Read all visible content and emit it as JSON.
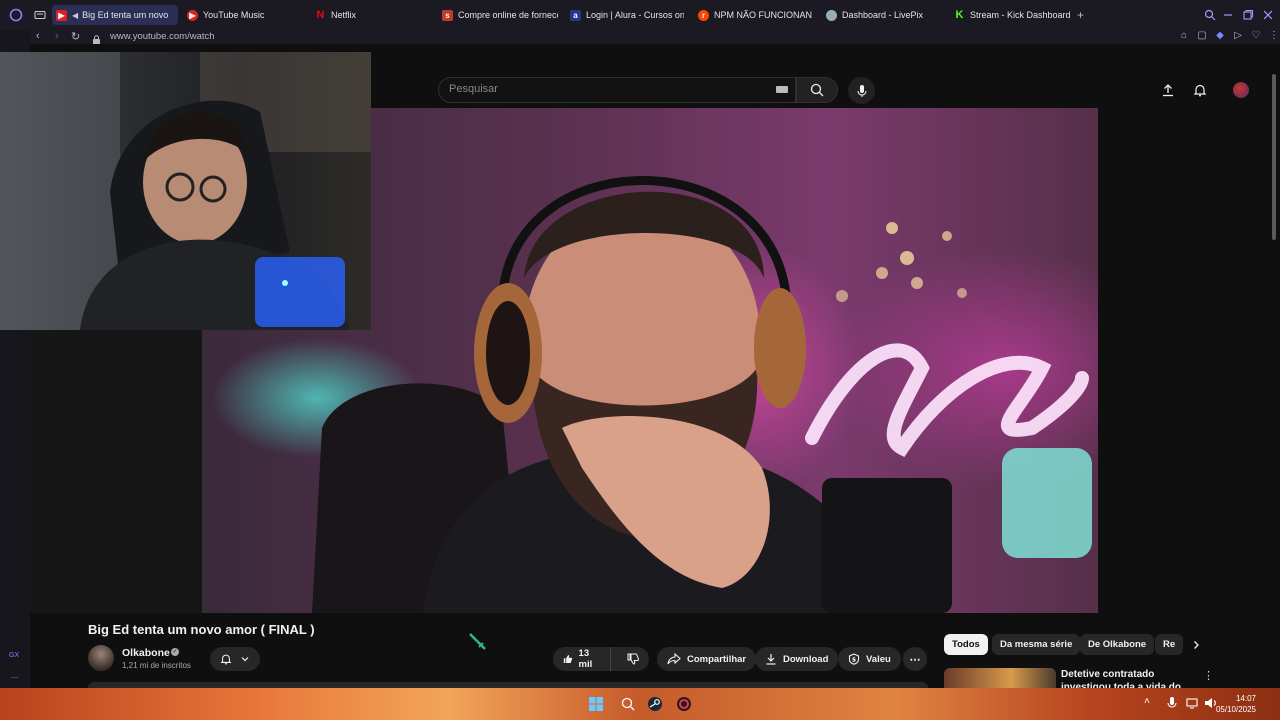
{
  "browser": {
    "tabs": [
      {
        "label": "Big Ed tenta um novo",
        "favicon": "youtube-icon",
        "active": true
      },
      {
        "label": "YouTube Music",
        "favicon": "youtube-music-icon",
        "active": false
      },
      {
        "label": "Netflix",
        "favicon": "netflix-icon",
        "active": false
      },
      {
        "label": "Compre online de forneced",
        "favicon": "shop-icon",
        "active": false
      },
      {
        "label": "Login | Alura - Cursos on",
        "favicon": "alura-icon",
        "active": false
      },
      {
        "label": "NPM NÃO FUNCIONANDO",
        "favicon": "reddit-icon",
        "active": false
      },
      {
        "label": "Dashboard - LivePix",
        "favicon": "livepix-icon",
        "active": false
      },
      {
        "label": "Stream - Kick Dashboard",
        "favicon": "kick-icon",
        "active": false
      }
    ],
    "add_tab": "+",
    "url": "www.youtube.com/watch"
  },
  "youtube": {
    "search_placeholder": "Pesquisar",
    "video_title": "Big Ed tenta um novo amor ( FINAL )",
    "channel_name": "Olkabone",
    "subscribers": "1,21 mi de inscritos",
    "likes": "13 mil",
    "share_label": "Compartilhar",
    "download_label": "Download",
    "thanks_label": "Valeu",
    "chips": [
      "Todos",
      "Da mesma série",
      "De Olkabone",
      "Re"
    ],
    "recommendation_title": "Detetive contratado investigou toda a vida do Michael e mostr..."
  },
  "sidebar": {
    "label_gx": "GX",
    "label_more": "..."
  },
  "taskbar": {
    "time": "14:07",
    "date": "05/10/2025"
  },
  "colors": {
    "youtube_bg": "#0f0f0f",
    "tab_active": "#2c2f55",
    "chip_active": "#f1f1f1"
  }
}
